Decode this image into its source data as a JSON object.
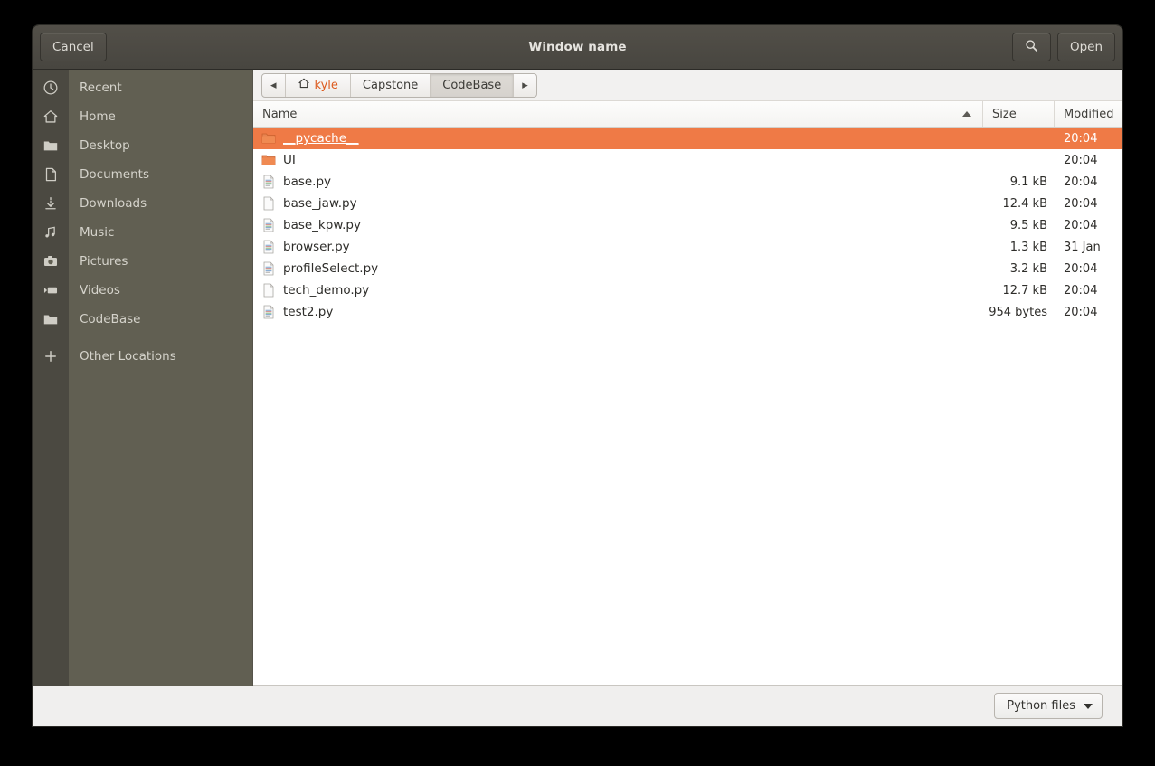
{
  "window": {
    "title": "Window name",
    "cancel_label": "Cancel",
    "open_label": "Open",
    "search_icon": "search-icon"
  },
  "colors": {
    "selection": "#ef7a46",
    "header_bg": "#4d4b44",
    "sidebar_bg": "#615f52",
    "sidebar_icon_bg": "#4b4941",
    "accent_text": "#dd5c20"
  },
  "sidebar": {
    "items": [
      {
        "label": "Recent",
        "icon": "clock-icon"
      },
      {
        "label": "Home",
        "icon": "home-icon"
      },
      {
        "label": "Desktop",
        "icon": "folder-icon"
      },
      {
        "label": "Documents",
        "icon": "document-icon"
      },
      {
        "label": "Downloads",
        "icon": "download-icon"
      },
      {
        "label": "Music",
        "icon": "music-icon"
      },
      {
        "label": "Pictures",
        "icon": "camera-icon"
      },
      {
        "label": "Videos",
        "icon": "video-icon"
      },
      {
        "label": "CodeBase",
        "icon": "folder-icon"
      },
      {
        "label": "Other Locations",
        "icon": "plus-icon"
      }
    ]
  },
  "pathbar": {
    "back_arrow": "◂",
    "forward_arrow": "▸",
    "crumbs": [
      {
        "label": "kyle",
        "icon": "home-icon",
        "active": false
      },
      {
        "label": "Capstone",
        "icon": "",
        "active": false
      },
      {
        "label": "CodeBase",
        "icon": "",
        "active": true
      }
    ]
  },
  "filelist": {
    "columns": {
      "name": "Name",
      "size": "Size",
      "modified": "Modified"
    },
    "sort_column": "Name",
    "sort_direction": "ascending",
    "rows": [
      {
        "name": "__pycache__",
        "size": "",
        "modified": "20:04",
        "icon": "folder-icon",
        "selected": true
      },
      {
        "name": "UI",
        "size": "",
        "modified": "20:04",
        "icon": "folder-icon",
        "selected": false
      },
      {
        "name": "base.py",
        "size": "9.1 kB",
        "modified": "20:04",
        "icon": "text-file-icon",
        "selected": false
      },
      {
        "name": "base_jaw.py",
        "size": "12.4 kB",
        "modified": "20:04",
        "icon": "blank-file-icon",
        "selected": false
      },
      {
        "name": "base_kpw.py",
        "size": "9.5 kB",
        "modified": "20:04",
        "icon": "text-file-icon",
        "selected": false
      },
      {
        "name": "browser.py",
        "size": "1.3 kB",
        "modified": "31 Jan",
        "icon": "text-file-icon",
        "selected": false
      },
      {
        "name": "profileSelect.py",
        "size": "3.2 kB",
        "modified": "20:04",
        "icon": "text-file-icon",
        "selected": false
      },
      {
        "name": "tech_demo.py",
        "size": "12.7 kB",
        "modified": "20:04",
        "icon": "blank-file-icon",
        "selected": false
      },
      {
        "name": "test2.py",
        "size": "954 bytes",
        "modified": "20:04",
        "icon": "text-file-icon",
        "selected": false
      }
    ]
  },
  "footer": {
    "filter_label": "Python files",
    "filter_icon": "chevron-down-icon"
  }
}
